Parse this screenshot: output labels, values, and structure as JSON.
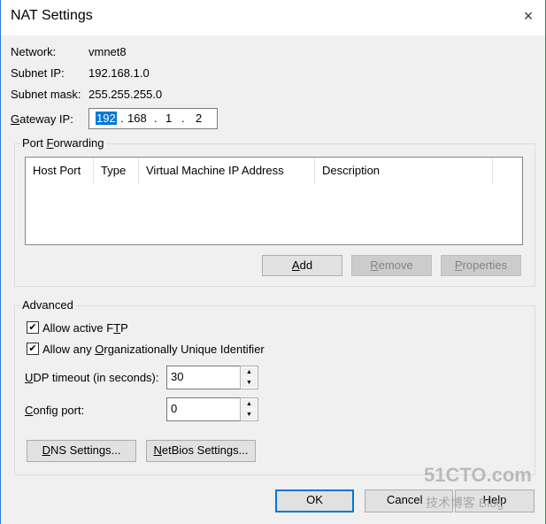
{
  "window": {
    "title": "NAT Settings",
    "close_icon": "×"
  },
  "info": {
    "network_label": "Network:",
    "network_value": "vmnet8",
    "subnet_ip_label": "Subnet IP:",
    "subnet_ip_value": "192.168.1.0",
    "subnet_mask_label": "Subnet mask:",
    "subnet_mask_value": "255.255.255.0",
    "gateway_label": {
      "key": "G",
      "post": "ateway IP:"
    },
    "gateway_octets": [
      "192",
      "168",
      "1",
      "2"
    ]
  },
  "port_forwarding": {
    "label": {
      "pre": "Port ",
      "key": "F",
      "post": "orwarding"
    },
    "columns": [
      "Host Port",
      "Type",
      "Virtual Machine IP Address",
      "Description"
    ],
    "rows": [],
    "add": {
      "key": "A",
      "post": "dd"
    },
    "remove": {
      "key": "R",
      "post": "emove"
    },
    "properties": {
      "key": "P",
      "post": "roperties"
    }
  },
  "advanced": {
    "label": "Advanced",
    "allow_ftp": {
      "pre": "Allow active F",
      "key": "T",
      "post": "P",
      "checked": true
    },
    "allow_oui": {
      "pre": "Allow any ",
      "key": "O",
      "post": "rganizationally Unique Identifier",
      "checked": true
    },
    "udp_label": {
      "key": "U",
      "post": "DP timeout (in seconds):"
    },
    "udp_value": "30",
    "config_label": {
      "key": "C",
      "post": "onfig port:"
    },
    "config_value": "0",
    "dns": {
      "key": "D",
      "post": "NS Settings..."
    },
    "netbios": {
      "key": "N",
      "post": "etBios Settings..."
    }
  },
  "footer": {
    "ok": "OK",
    "cancel": "Cancel",
    "help": "Help"
  },
  "watermark": {
    "line1": "51CTO.com",
    "line2": "技术博客 Blog"
  }
}
